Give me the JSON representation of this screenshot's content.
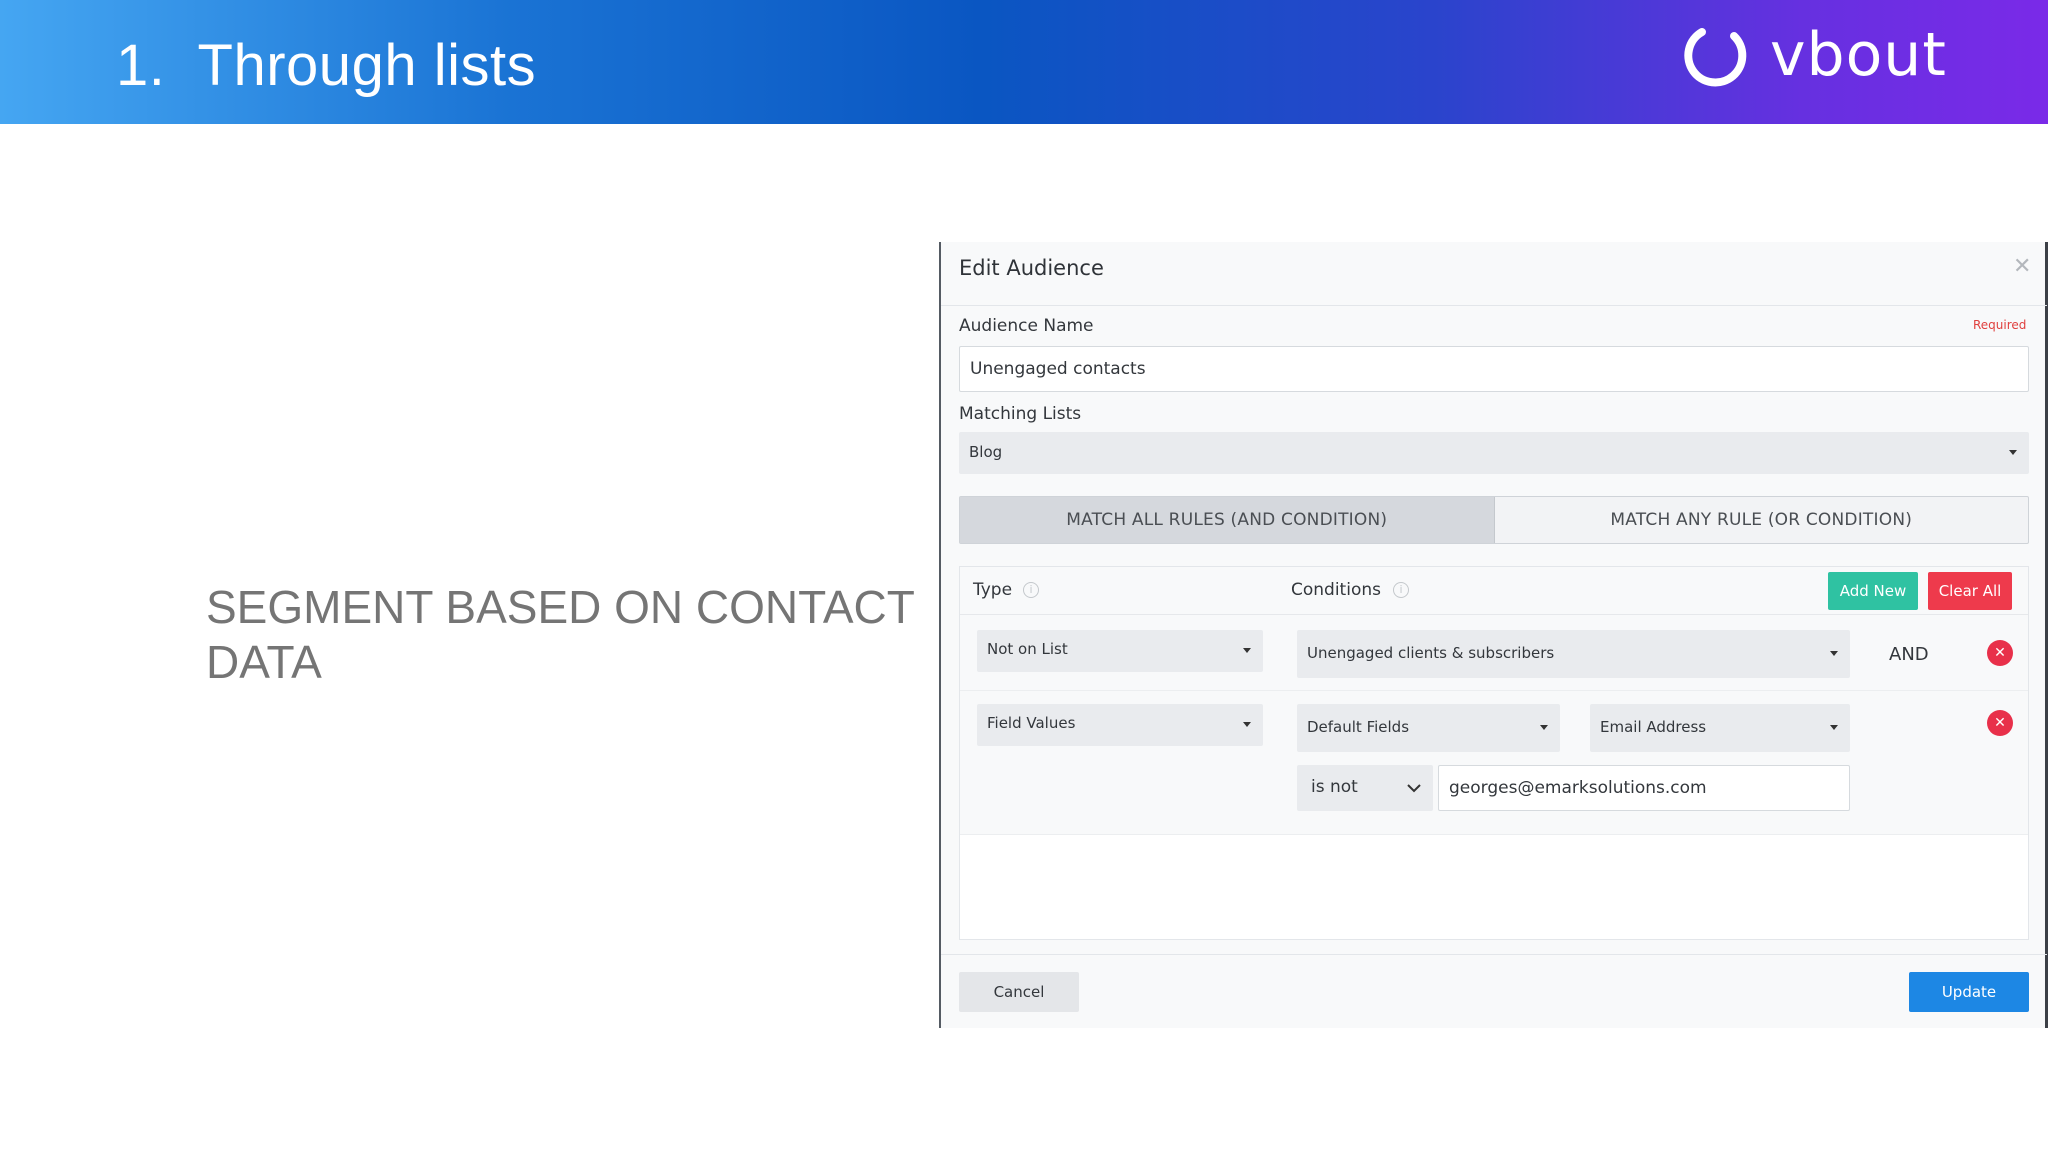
{
  "slide": {
    "title": "1.  Through lists",
    "logo_text": "vbout",
    "caption": "SEGMENT BASED ON CONTACT DATA"
  },
  "modal": {
    "title": "Edit Audience",
    "close_icon": "close-icon",
    "audience_name_label": "Audience Name",
    "required_label": "Required",
    "audience_name_value": "Unengaged contacts",
    "matching_lists_label": "Matching Lists",
    "matching_lists_value": "Blog",
    "match_all_label": "MATCH ALL RULES (AND CONDITION)",
    "match_any_label": "MATCH ANY RULE (OR CONDITION)",
    "match_mode_selected": "all",
    "rules": {
      "type_header": "Type",
      "conditions_header": "Conditions",
      "info_icon": "info-icon",
      "add_new_label": "Add New",
      "clear_all_label": "Clear All",
      "row1": {
        "type": "Not on List",
        "condition": "Unengaged clients & subscribers",
        "joiner": "AND"
      },
      "row2": {
        "type": "Field Values",
        "field_group": "Default Fields",
        "field": "Email Address",
        "operator": "is not",
        "value": "georges@emarksolutions.com"
      }
    },
    "cancel_label": "Cancel",
    "update_label": "Update"
  },
  "colors": {
    "add_new": "#2fc2a2",
    "clear_all": "#ee3a4c",
    "update": "#1d87e4",
    "remove": "#e8304a",
    "required": "#e0403e"
  }
}
